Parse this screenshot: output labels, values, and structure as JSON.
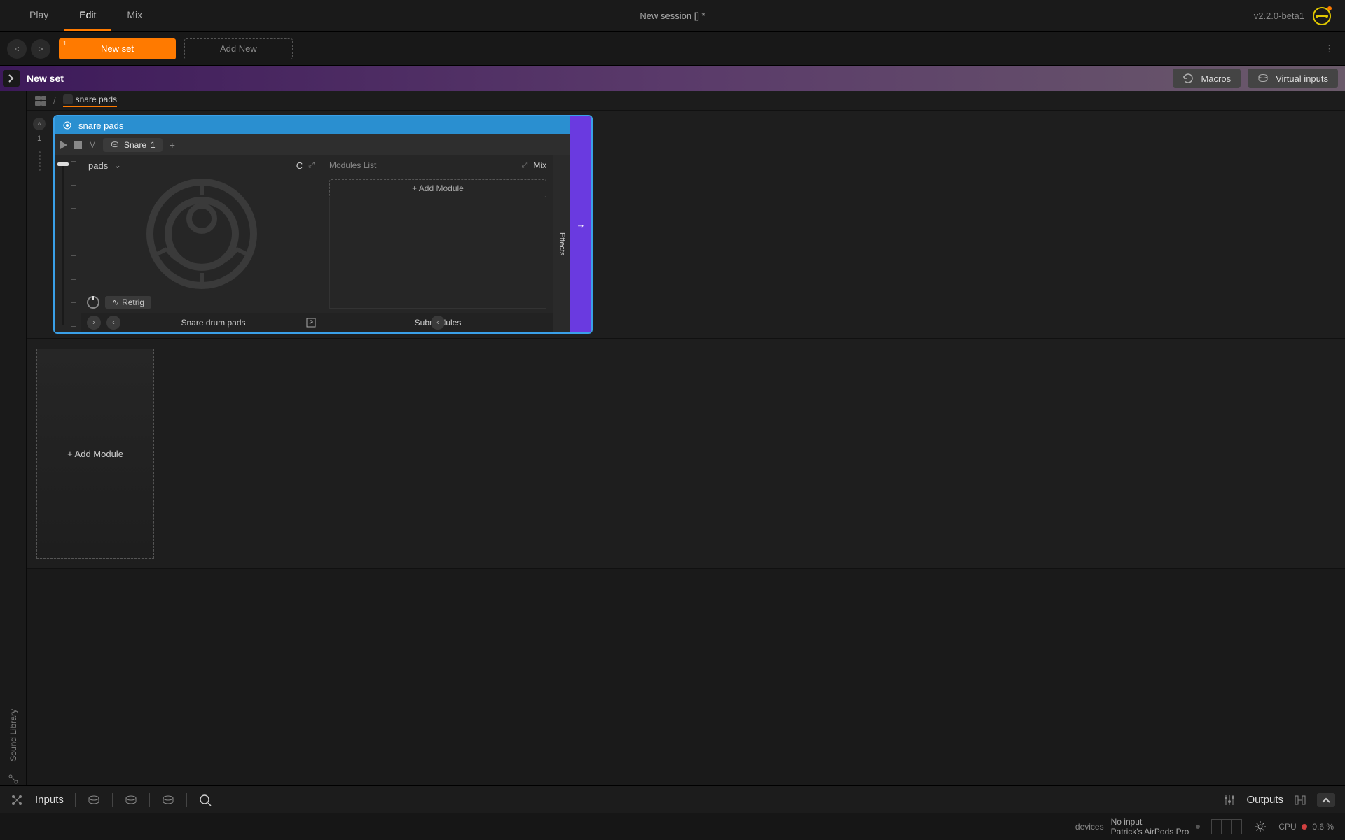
{
  "topbar": {
    "tabs": {
      "play": "Play",
      "edit": "Edit",
      "mix": "Mix"
    },
    "session_title": "New session  [] *",
    "version": "v2.2.0-beta1"
  },
  "setstrip": {
    "back": "<",
    "forward": ">",
    "set_num": "1",
    "set_label": "New set",
    "add_new": "Add New",
    "more": "⋮"
  },
  "purplebar": {
    "expand": ">",
    "title": "New set",
    "macros": "Macros",
    "virtual_inputs": "Virtual inputs"
  },
  "breadcrumb": {
    "sep": "/",
    "item": "snare pads"
  },
  "gutter": {
    "num": "1",
    "collapse": "˄"
  },
  "module": {
    "title": "snare pads",
    "arrow": "→",
    "play": "▶",
    "stop": "■",
    "mute": "M",
    "snare_label": "Snare",
    "snare_num": "1",
    "plus": "+",
    "pad_drop": "pads",
    "c_label": "C",
    "expand1": "⤢",
    "modules_list": "Modules List",
    "expand2": "⤢",
    "mix": "Mix",
    "add_module": "+ Add Module",
    "retrig": "Retrig",
    "footer_left": "Snare drum pads",
    "footer_right": "Submodules",
    "effects": "Effects"
  },
  "row2": {
    "add_module": "+ Add Module"
  },
  "leftrail": {
    "sound_library": "Sound Library"
  },
  "iobar": {
    "inputs": "Inputs",
    "outputs": "Outputs"
  },
  "status": {
    "devices": "devices",
    "line1": "No input",
    "line2": "Patrick's AirPods Pro",
    "cpu_label": "CPU",
    "cpu_pct": "0.6 %"
  }
}
